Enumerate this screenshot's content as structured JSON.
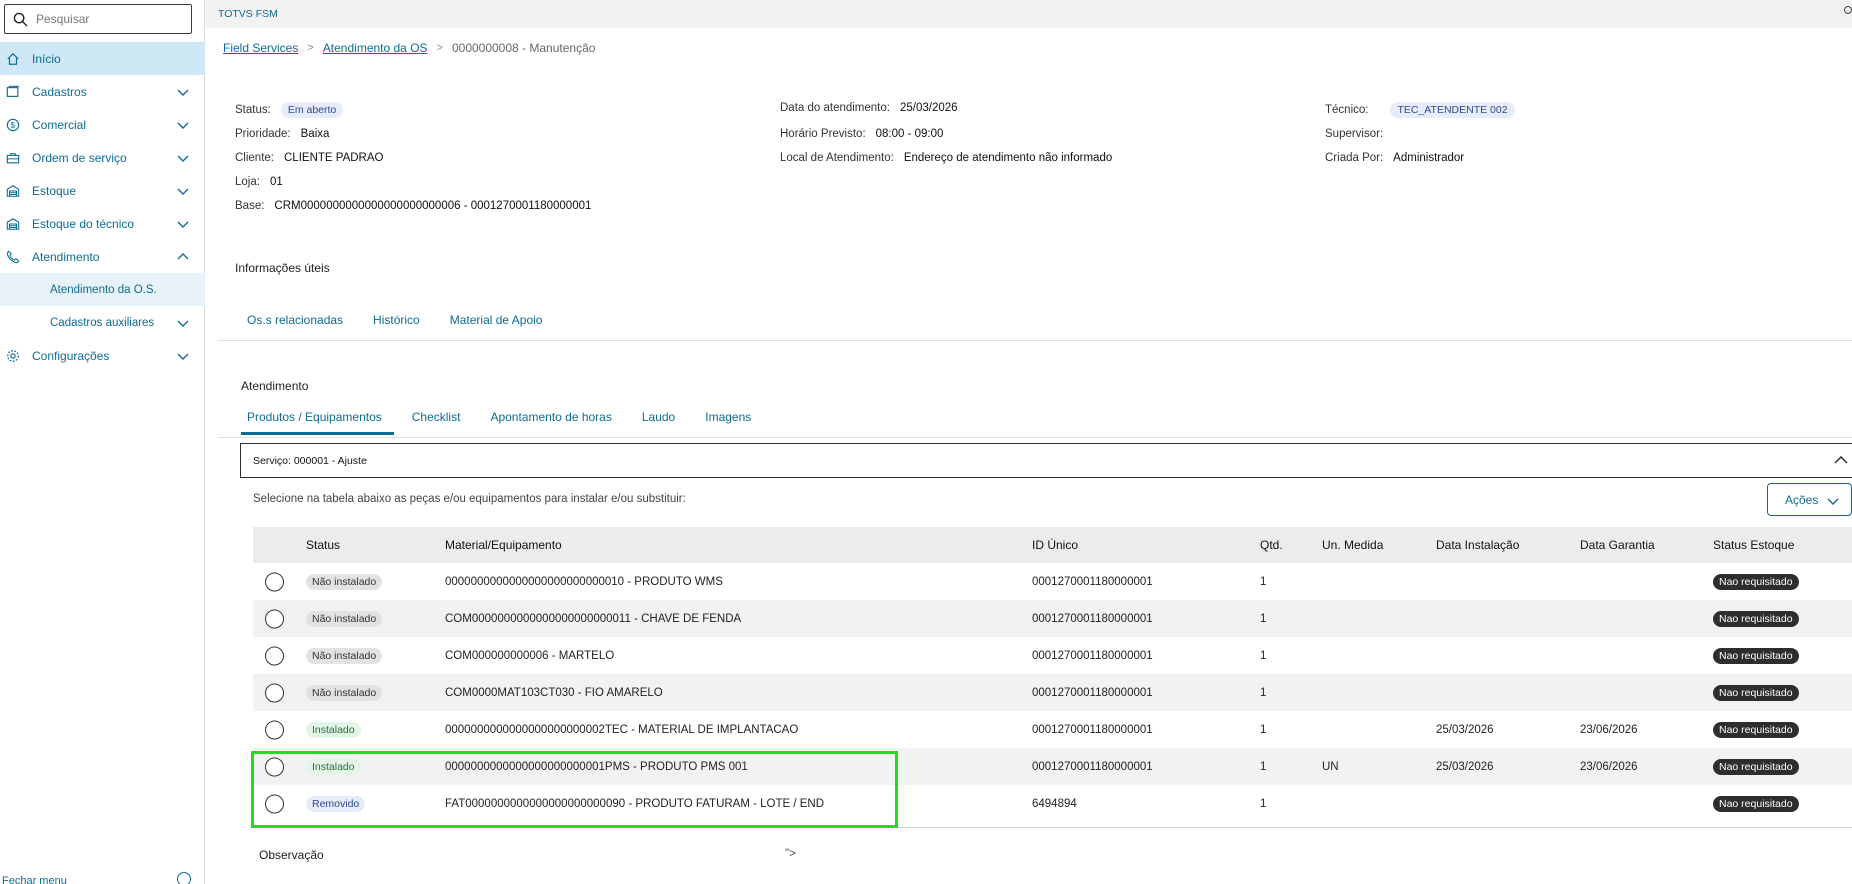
{
  "search": {
    "placeholder": "Pesquisar"
  },
  "sidebar": {
    "items": [
      {
        "label": "Início",
        "icon": "home-icon"
      },
      {
        "label": "Cadastros",
        "icon": "cards-icon"
      },
      {
        "label": "Comercial",
        "icon": "dollar-icon"
      },
      {
        "label": "Ordem de serviço",
        "icon": "toolbox-icon"
      },
      {
        "label": "Estoque",
        "icon": "warehouse-icon"
      },
      {
        "label": "Estoque do técnico",
        "icon": "warehouse-icon"
      },
      {
        "label": "Atendimento",
        "icon": "phone-icon"
      },
      {
        "label": "Configurações",
        "icon": "gear-icon"
      }
    ],
    "subitems": [
      {
        "label": "Atendimento da O.S."
      },
      {
        "label": "Cadastros auxiliares"
      }
    ],
    "footer": "Fechar menu"
  },
  "topbar": {
    "title": "TOTVS FSM"
  },
  "breadcrumb": {
    "level1": "Field Services",
    "level2": "Atendimento da OS",
    "current": "0000000008 - Manutenção"
  },
  "info": {
    "status_label": "Status:",
    "status_value": "Em aberto",
    "prioridade_label": "Prioridade:",
    "prioridade_value": "Baixa",
    "cliente_label": "Cliente:",
    "cliente_value": "CLIENTE PADRAO",
    "loja_label": "Loja:",
    "loja_value": "01",
    "base_label": "Base:",
    "base_value": "CRM0000000000000000000000006 - 0001270001180000001",
    "data_label": "Data do atendimento:",
    "data_value": "25/03/2026",
    "horario_label": "Horário Previsto:",
    "horario_value": "08:00 - 09:00",
    "local_label": "Local de Atendimento:",
    "local_value": "Endereço de atendimento não informado",
    "tecnico_label": "Técnico:",
    "tecnico_value": "TEC_ATENDENTE 002",
    "supervisor_label": "Supervisor:",
    "criada_label": "Criada Por:",
    "criada_value": "Administrador"
  },
  "info_uteis": {
    "title": "Informações úteis",
    "tabs": [
      "Os.s relacionadas",
      "Histórico",
      "Material de Apoio"
    ]
  },
  "atendimento": {
    "title": "Atendimento",
    "tabs": [
      "Produtos / Equipamentos",
      "Checklist",
      "Apontamento de horas",
      "Laudo",
      "Imagens"
    ],
    "service": "Serviço: 000001 - Ajuste",
    "hint": "Selecione na tabela abaixo as peças e/ou equipamentos para instalar e/ou substituir:",
    "acoes_label": "Ações"
  },
  "table": {
    "columns": [
      "Status",
      "Material/Equipamento",
      "ID Único",
      "Qtd.",
      "Un. Medida",
      "Data Instalação",
      "Data Garantia",
      "Status Estoque"
    ],
    "rows": [
      {
        "status": "Não instalado",
        "material": "0000000000000000000000000010 - PRODUTO WMS",
        "id": "0001270001180000001",
        "qtd": "1",
        "un": "",
        "inst": "",
        "gar": "",
        "estoque": "Nao requisitado"
      },
      {
        "status": "Não instalado",
        "material": "COM0000000000000000000000011 - CHAVE DE FENDA",
        "id": "0001270001180000001",
        "qtd": "1",
        "un": "",
        "inst": "",
        "gar": "",
        "estoque": "Nao requisitado"
      },
      {
        "status": "Não instalado",
        "material": "COM000000000006 - MARTELO",
        "id": "0001270001180000001",
        "qtd": "1",
        "un": "",
        "inst": "",
        "gar": "",
        "estoque": "Nao requisitado"
      },
      {
        "status": "Não instalado",
        "material": "COM0000MAT103CT030 - FIO AMARELO",
        "id": "0001270001180000001",
        "qtd": "1",
        "un": "",
        "inst": "",
        "gar": "",
        "estoque": "Nao requisitado"
      },
      {
        "status": "Instalado",
        "material": "0000000000000000000000002TEC - MATERIAL DE IMPLANTACAO",
        "id": "0001270001180000001",
        "qtd": "1",
        "un": "",
        "inst": "25/03/2026",
        "gar": "23/06/2026",
        "estoque": "Nao requisitado"
      },
      {
        "status": "Instalado",
        "material": "0000000000000000000000001PMS - PRODUTO PMS 001",
        "id": "0001270001180000001",
        "qtd": "1",
        "un": "UN",
        "inst": "25/03/2026",
        "gar": "23/06/2026",
        "estoque": "Nao requisitado"
      },
      {
        "status": "Removido",
        "material": "FAT0000000000000000000000090 - PRODUTO FATURAM - LOTE / END",
        "id": "6494894",
        "qtd": "1",
        "un": "",
        "inst": "",
        "gar": "",
        "estoque": "Nao requisitado"
      }
    ]
  },
  "observacao": {
    "label": "Observação",
    "value": "\">"
  },
  "colors": {
    "accent": "#0c6c94",
    "active_menu": "#cfe8f5",
    "highlight": "#2bd62b"
  }
}
